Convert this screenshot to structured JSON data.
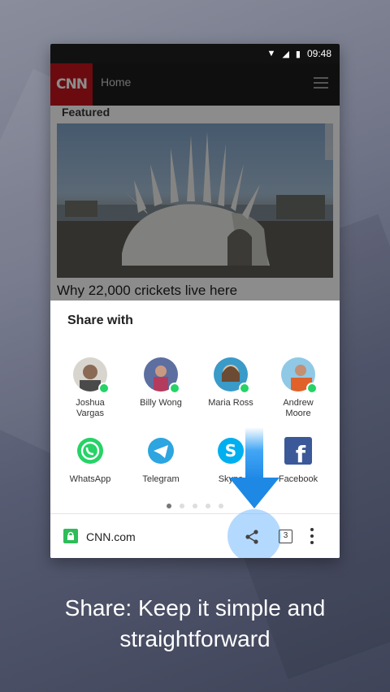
{
  "status_bar": {
    "time": "09:48"
  },
  "app_bar": {
    "logo": "CNN",
    "title": "Home"
  },
  "content": {
    "section": "Featured",
    "headline": "Why 22,000 crickets live here"
  },
  "share_sheet": {
    "title": "Share with",
    "contacts": [
      {
        "name": "Joshua\nVargas"
      },
      {
        "name": "Billy Wong"
      },
      {
        "name": "Maria Ross"
      },
      {
        "name": "Andrew\nMoore"
      }
    ],
    "apps": [
      {
        "label": "WhatsApp",
        "icon": "whatsapp-icon",
        "color": "#25d366"
      },
      {
        "label": "Telegram",
        "icon": "telegram-icon",
        "color": "#2ca5e0"
      },
      {
        "label": "Skype",
        "icon": "skype-icon",
        "color": "#00aff0"
      },
      {
        "label": "Facebook",
        "icon": "facebook-icon",
        "color": "#3b5998"
      }
    ],
    "page_count": 5,
    "active_page": 1
  },
  "bottom_bar": {
    "domain": "CNN.com",
    "tab_count": "3"
  },
  "tagline": "Share: Keep it simple and straightforward",
  "colors": {
    "accent": "#2196f3",
    "cnn_red": "#c4151c",
    "lock_green": "#2ebd59"
  }
}
